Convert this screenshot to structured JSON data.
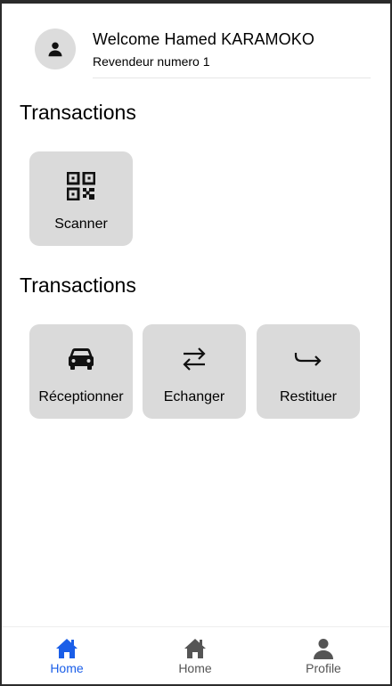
{
  "header": {
    "welcome": "Welcome Hamed KARAMOKO",
    "subtitle": "Revendeur numero 1",
    "avatar_icon": "person-icon"
  },
  "sections": [
    {
      "title": "Transactions",
      "tiles": [
        {
          "label": "Scanner",
          "icon": "qr-code-icon"
        }
      ]
    },
    {
      "title": "Transactions",
      "tiles": [
        {
          "label": "Réceptionner",
          "icon": "car-icon"
        },
        {
          "label": "Echanger",
          "icon": "swap-arrows-icon"
        },
        {
          "label": "Restituer",
          "icon": "return-arrow-icon"
        }
      ]
    }
  ],
  "bottom_nav": {
    "items": [
      {
        "label": "Home",
        "icon": "home-icon",
        "active": true
      },
      {
        "label": "Home",
        "icon": "home-icon",
        "active": false
      },
      {
        "label": "Profile",
        "icon": "person-icon",
        "active": false
      }
    ]
  },
  "colors": {
    "accent": "#1a5ee8",
    "inactive": "#555555",
    "tile_bg": "#dadada",
    "avatar_bg": "#dcdcdc"
  }
}
